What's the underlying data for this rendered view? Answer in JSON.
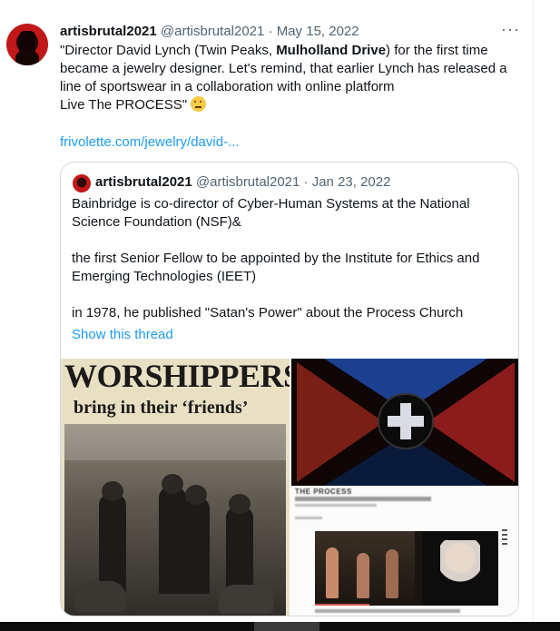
{
  "tweet": {
    "author_name": "artisbrutal2021",
    "author_handle": "@artisbrutal2021",
    "date": "May 15, 2022",
    "text_1": "\"Director David Lynch (Twin Peaks, ",
    "text_bold": "Mulholland Drive",
    "text_2": ") for the first time became a jewelry designer. Let's remind, that earlier Lynch has released a line of sportswear in a collaboration with online platform",
    "text_3": "Live The PROCESS\"",
    "emoji_name": "thinking-face-emoji",
    "link": "frivolette.com/jewelry/david-..."
  },
  "quote": {
    "author_name": "artisbrutal2021",
    "author_handle": "@artisbrutal2021",
    "date": "Jan 23, 2022",
    "paragraphs": [
      "Bainbridge is  co-director of Cyber-Human Systems at the National Science Foundation (NSF)&",
      "the first Senior Fellow to be appointed by the Institute for Ethics and Emerging Technologies (IEET)",
      "in 1978, he published \"Satan's Power\" about the Process Church"
    ],
    "show_thread": "Show this thread"
  },
  "media": {
    "left_headline": "WORSHIPPERS",
    "left_sub": "bring in their ‘friends’",
    "right_bottom_title": "THE PROCESS"
  },
  "icons": {
    "more": "more-options-icon"
  },
  "colors": {
    "link": "#1d9bf0",
    "text": "#0f1419",
    "meta": "#536471",
    "border": "#cfd9de"
  }
}
